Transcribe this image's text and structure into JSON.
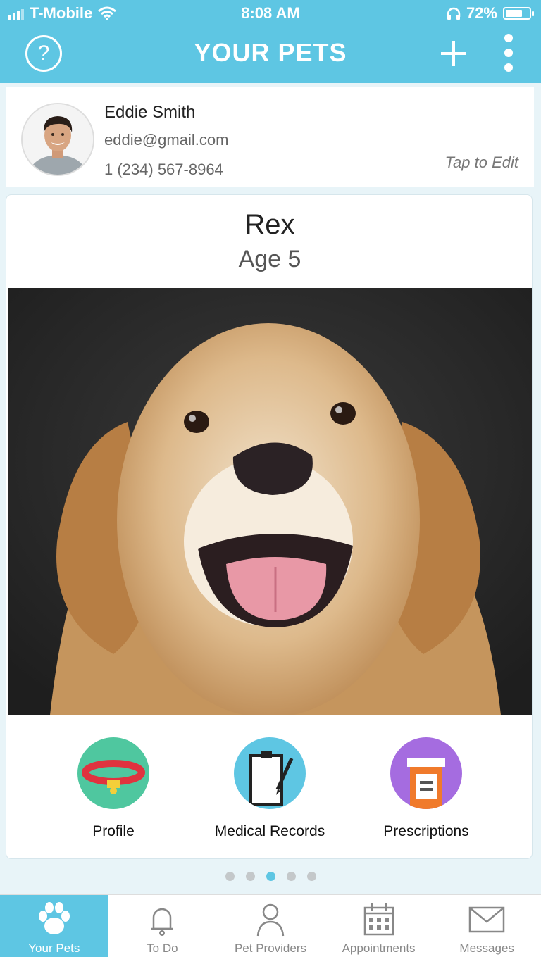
{
  "status_bar": {
    "carrier": "T-Mobile",
    "time": "8:08 AM",
    "battery": "72%",
    "battery_level": 0.72
  },
  "header": {
    "title": "YOUR PETS",
    "help_label": "?",
    "colors": {
      "accent": "#5ec6e3"
    }
  },
  "user": {
    "name": "Eddie Smith",
    "email": "eddie@gmail.com",
    "phone": "1 (234) 567-8964",
    "edit_hint": "Tap to Edit"
  },
  "pet": {
    "name": "Rex",
    "age": "Age 5"
  },
  "actions": [
    {
      "label": "Profile",
      "icon": "collar-icon",
      "color": "#4fc79f"
    },
    {
      "label": "Medical Records",
      "icon": "clipboard-icon",
      "color": "#5ec6e3"
    },
    {
      "label": "Prescriptions",
      "icon": "pill-bottle-icon",
      "color": "#a56ce0"
    }
  ],
  "pager": {
    "count": 5,
    "active_index": 2
  },
  "tabs": [
    {
      "label": "Your Pets",
      "icon": "paw-icon",
      "active": true
    },
    {
      "label": "To Do",
      "icon": "bell-icon",
      "active": false
    },
    {
      "label": "Pet Providers",
      "icon": "person-icon",
      "active": false
    },
    {
      "label": "Appointments",
      "icon": "calendar-icon",
      "active": false
    },
    {
      "label": "Messages",
      "icon": "envelope-icon",
      "active": false
    }
  ]
}
